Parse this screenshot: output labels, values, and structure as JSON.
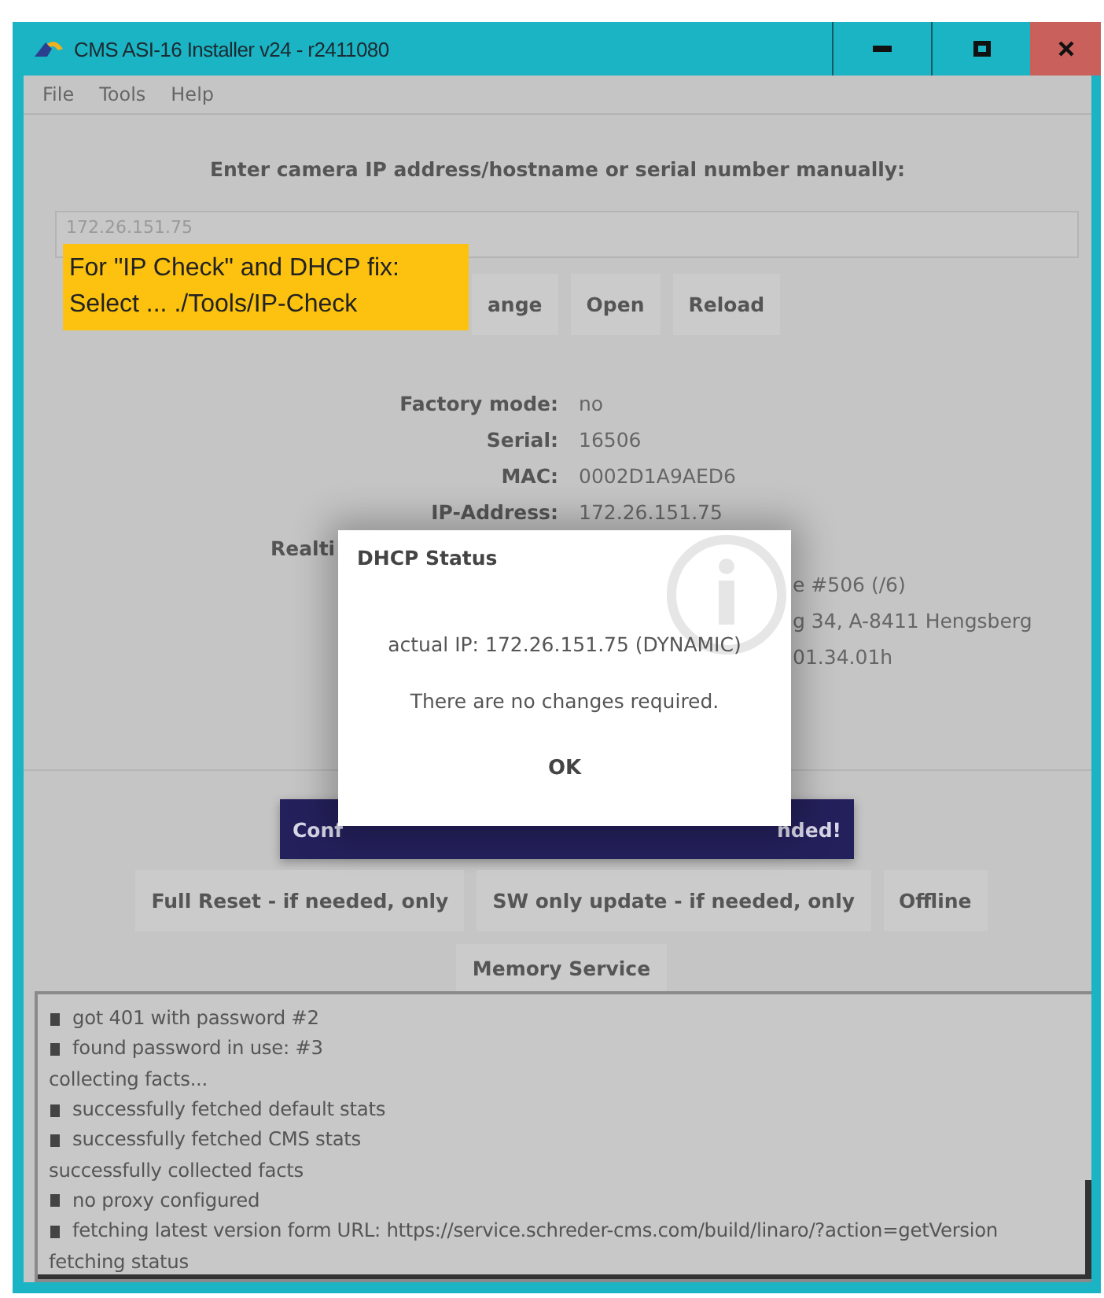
{
  "window": {
    "title": "CMS ASI-16 Installer v24 - r2411080"
  },
  "menu": [
    {
      "label": "File"
    },
    {
      "label": "Tools"
    },
    {
      "label": "Help"
    }
  ],
  "prompt": "Enter camera IP address/hostname or serial number manually:",
  "address_field": {
    "placeholder": "172.26.151.75"
  },
  "buttons": [
    {
      "label": "ange"
    },
    {
      "label": "Open"
    },
    {
      "label": "Reload"
    }
  ],
  "note": {
    "lines": [
      "For \"IP Check\" and DHCP fix:",
      "Select ... ./Tools/IP-Check"
    ]
  },
  "info": [
    {
      "kind": "pair",
      "label": "Factory mode:",
      "value": "no"
    },
    {
      "kind": "pair",
      "label": "Serial:",
      "value": "16506"
    },
    {
      "kind": "pair",
      "label": "MAC:",
      "value": "0002D1A9AED6"
    },
    {
      "kind": "pair",
      "label": "IP-Address:",
      "value": "172.26.151.75"
    },
    {
      "kind": "label",
      "label": "Realti"
    },
    {
      "kind": "value",
      "value": "e #506 (/6)"
    },
    {
      "kind": "value",
      "value": "g 34, A-8411 Hengsberg"
    },
    {
      "kind": "value",
      "value": "01.34.01h"
    }
  ],
  "primary_button": {
    "left": "Conf",
    "right": "nded!"
  },
  "action_buttons": [
    {
      "label": "Full Reset - if needed, only"
    },
    {
      "label": "SW only update - if needed, only"
    },
    {
      "label": "Offline"
    }
  ],
  "service_button": {
    "label": "Memory Service"
  },
  "log": [
    {
      "kind": "bullet",
      "text": "got 401 with password #2"
    },
    {
      "kind": "bullet",
      "text": "found password in use: #3"
    },
    {
      "kind": "plain",
      "text": "collecting facts..."
    },
    {
      "kind": "bullet",
      "text": "successfully fetched default stats"
    },
    {
      "kind": "bullet",
      "text": "successfully fetched CMS stats"
    },
    {
      "kind": "plain",
      "text": "successfully collected facts"
    },
    {
      "kind": "bullet",
      "text": "no proxy configured"
    },
    {
      "kind": "bullet",
      "text": "fetching latest version form URL: https://service.schreder-cms.com/build/linaro/?action=getVersion"
    },
    {
      "kind": "plain",
      "text": "fetching status"
    }
  ],
  "dialog": {
    "title": "DHCP Status",
    "message": "actual IP: 172.26.151.75 (DYNAMIC)",
    "detail": "There are no changes required.",
    "button": "OK"
  }
}
